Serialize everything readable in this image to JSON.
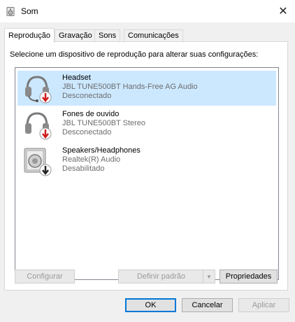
{
  "window": {
    "title": "Som",
    "close_glyph": "✕",
    "icon": "speaker-icon"
  },
  "tabs": [
    {
      "label": "Reprodução",
      "active": true
    },
    {
      "label": "Gravação",
      "active": false
    },
    {
      "label": "Sons",
      "active": false
    },
    {
      "label": "Comunicações",
      "active": false
    }
  ],
  "instruction": "Selecione um dispositivo de reprodução para alterar suas configurações:",
  "devices": [
    {
      "name": "Headset",
      "description": "JBL TUNE500BT Hands-Free AG Audio",
      "status": "Desconectado",
      "icon": "headset-icon",
      "status_icon": "red-down-arrow-icon",
      "selected": true
    },
    {
      "name": "Fones de ouvido",
      "description": "JBL TUNE500BT Stereo",
      "status": "Desconectado",
      "icon": "headphones-icon",
      "status_icon": "red-down-arrow-icon",
      "selected": false
    },
    {
      "name": "Speakers/Headphones",
      "description": "Realtek(R) Audio",
      "status": "Desabilitado",
      "icon": "speaker-box-icon",
      "status_icon": "black-down-arrow-icon",
      "selected": false
    }
  ],
  "buttons": {
    "configure": "Configurar",
    "set_default": "Definir padrão",
    "properties": "Propriedades",
    "ok": "OK",
    "cancel": "Cancelar",
    "apply": "Aplicar"
  },
  "colors": {
    "selection": "#cce8ff",
    "default_button_border": "#0078d7",
    "status_red": "#d01c1c"
  }
}
